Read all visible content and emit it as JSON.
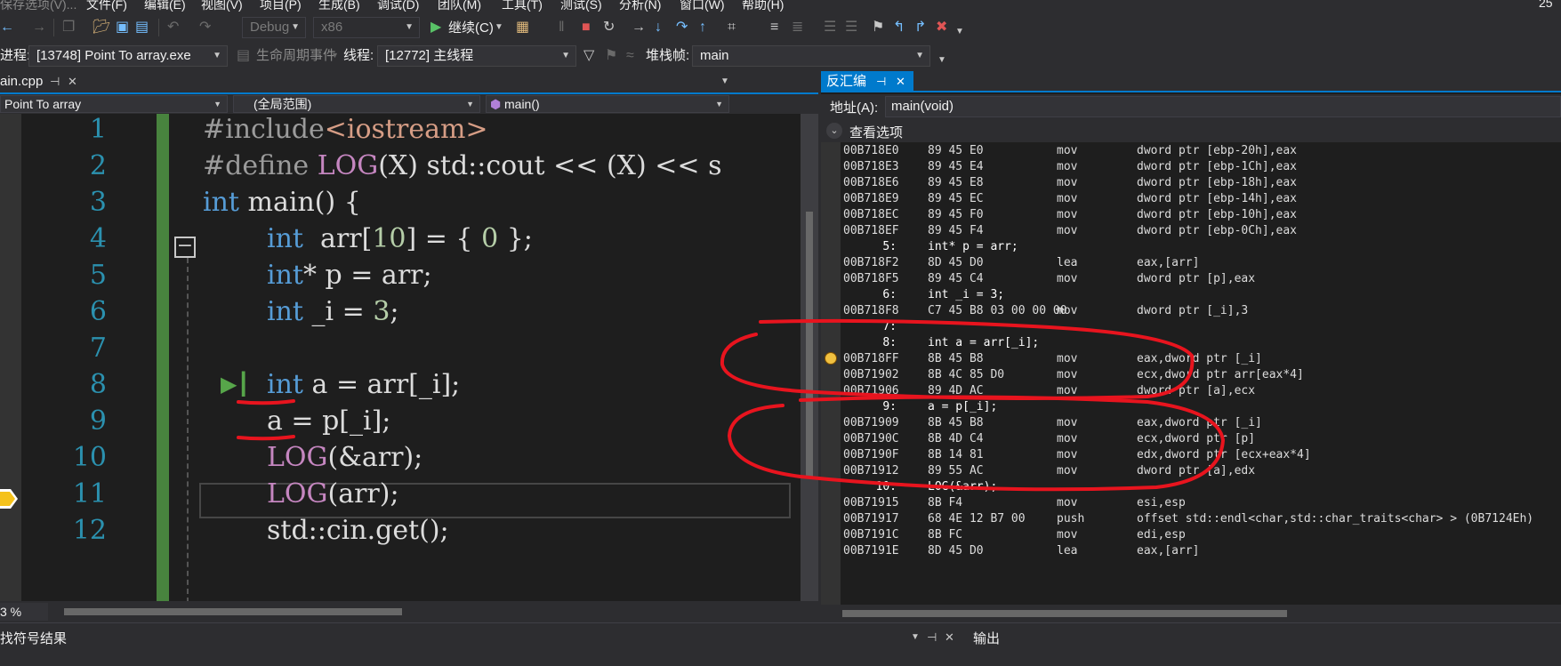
{
  "menu": {
    "items": [
      "保存选项(V)...",
      "文件(F)",
      "编辑(E)",
      "视图(V)",
      "项目(P)",
      "生成(B)",
      "调试(D)",
      "团队(M)",
      "工具(T)",
      "测试(S)",
      "分析(N)",
      "窗口(W)",
      "帮助(H)"
    ],
    "page_indicator": "25"
  },
  "toolbar": {
    "config": "Debug",
    "platform": "x86",
    "continue_label": "继续(C)"
  },
  "debug_location": {
    "process_label": "进程:",
    "process_value": "[13748] Point To array.exe",
    "lifecycle_label": "生命周期事件",
    "thread_label": "线程:",
    "thread_value": "[12772] 主线程",
    "stackframe_label": "堆栈帧:",
    "stackframe_value": "main"
  },
  "editor": {
    "file_tab": "ain.cpp",
    "nav_project": "Point To array",
    "nav_scope": "(全局范围)",
    "nav_function": "main()",
    "zoom": "3 %",
    "line_numbers": [
      "1",
      "2",
      "3",
      "4",
      "5",
      "6",
      "7",
      "8",
      "9",
      "10",
      "11",
      "12"
    ],
    "lines": {
      "l1_pre": "#include",
      "l1_inc": "<iostream>",
      "l2_pre": "#define ",
      "l2_mac": "LOG",
      "l2_rest": "(X) std::cout << (X) << s",
      "l3_kw": "int",
      "l3_rest": " main() {",
      "l4_kw": "int",
      "l4_a": "  arr[",
      "l4_n1": "10",
      "l4_b": "] = { ",
      "l4_n2": "0",
      "l4_c": " };",
      "l5_kw": "int",
      "l5_rest": "* p = arr;",
      "l6_kw": "int",
      "l6_a": " _i = ",
      "l6_n": "3",
      "l6_b": ";",
      "l8_kw": "int",
      "l8_rest": " a = arr[_i];",
      "l9": "a = p[_i];",
      "l10_mac": "LOG",
      "l10_rest": "(&arr);",
      "l11_mac": "LOG",
      "l11_rest": "(arr);",
      "l12": "std::cin.get();"
    }
  },
  "disasm": {
    "tab": "反汇编",
    "address_label": "地址(A):",
    "address_value": "main(void)",
    "view_options": "查看选项",
    "rows": [
      {
        "t": "i",
        "addr": "00B718E0",
        "bytes": "89 45 E0",
        "mn": "mov",
        "op": "dword ptr [ebp-20h],eax"
      },
      {
        "t": "i",
        "addr": "00B718E3",
        "bytes": "89 45 E4",
        "mn": "mov",
        "op": "dword ptr [ebp-1Ch],eax"
      },
      {
        "t": "i",
        "addr": "00B718E6",
        "bytes": "89 45 E8",
        "mn": "mov",
        "op": "dword ptr [ebp-18h],eax"
      },
      {
        "t": "i",
        "addr": "00B718E9",
        "bytes": "89 45 EC",
        "mn": "mov",
        "op": "dword ptr [ebp-14h],eax"
      },
      {
        "t": "i",
        "addr": "00B718EC",
        "bytes": "89 45 F0",
        "mn": "mov",
        "op": "dword ptr [ebp-10h],eax"
      },
      {
        "t": "i",
        "addr": "00B718EF",
        "bytes": "89 45 F4",
        "mn": "mov",
        "op": "dword ptr [ebp-0Ch],eax"
      },
      {
        "t": "s",
        "num": "5:",
        "src": "int* p = arr;"
      },
      {
        "t": "i",
        "addr": "00B718F2",
        "bytes": "8D 45 D0",
        "mn": "lea",
        "op": "eax,[arr]"
      },
      {
        "t": "i",
        "addr": "00B718F5",
        "bytes": "89 45 C4",
        "mn": "mov",
        "op": "dword ptr [p],eax"
      },
      {
        "t": "s",
        "num": "6:",
        "src": "int _i = 3;"
      },
      {
        "t": "i",
        "addr": "00B718F8",
        "bytes": "C7 45 B8 03 00 00 00",
        "mn": "mov",
        "op": "dword ptr [_i],3"
      },
      {
        "t": "s",
        "num": "7:",
        "src": ""
      },
      {
        "t": "s",
        "num": "8:",
        "src": "int a = arr[_i];"
      },
      {
        "t": "i",
        "addr": "00B718FF",
        "bytes": "8B 45 B8",
        "mn": "mov",
        "op": "eax,dword ptr [_i]"
      },
      {
        "t": "i",
        "addr": "00B71902",
        "bytes": "8B 4C 85 D0",
        "mn": "mov",
        "op": "ecx,dword ptr arr[eax*4]"
      },
      {
        "t": "i",
        "addr": "00B71906",
        "bytes": "89 4D AC",
        "mn": "mov",
        "op": "dword ptr [a],ecx"
      },
      {
        "t": "s",
        "num": "9:",
        "src": "a = p[_i];"
      },
      {
        "t": "i",
        "addr": "00B71909",
        "bytes": "8B 45 B8",
        "mn": "mov",
        "op": "eax,dword ptr [_i]"
      },
      {
        "t": "i",
        "addr": "00B7190C",
        "bytes": "8B 4D C4",
        "mn": "mov",
        "op": "ecx,dword ptr [p]"
      },
      {
        "t": "i",
        "addr": "00B7190F",
        "bytes": "8B 14 81",
        "mn": "mov",
        "op": "edx,dword ptr [ecx+eax*4]"
      },
      {
        "t": "i",
        "addr": "00B71912",
        "bytes": "89 55 AC",
        "mn": "mov",
        "op": "dword ptr [a],edx"
      },
      {
        "t": "s",
        "num": "10:",
        "src": "LOG(&arr);"
      },
      {
        "t": "i",
        "addr": "00B71915",
        "bytes": "8B F4",
        "mn": "mov",
        "op": "esi,esp"
      },
      {
        "t": "i",
        "addr": "00B71917",
        "bytes": "68 4E 12 B7 00",
        "mn": "push",
        "op": "offset std::endl<char,std::char_traits<char> > (0B7124Eh)"
      },
      {
        "t": "i",
        "addr": "00B7191C",
        "bytes": "8B FC",
        "mn": "mov",
        "op": "edi,esp"
      },
      {
        "t": "i",
        "addr": "00B7191E",
        "bytes": "8D 45 D0",
        "mn": "lea",
        "op": "eax,[arr]"
      }
    ]
  },
  "bottom": {
    "left_title": "找符号结果",
    "right_title": "输出"
  },
  "colors": {
    "accent": "#007acc",
    "annotation": "#e8141e"
  }
}
